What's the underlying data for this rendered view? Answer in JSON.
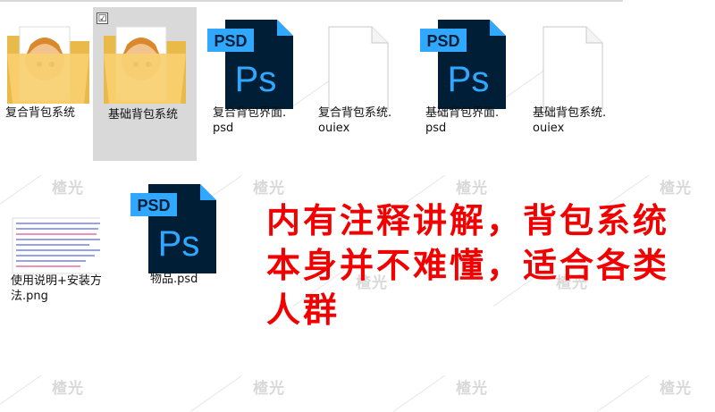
{
  "watermark": "楂光",
  "files": [
    {
      "name": "复合背包系统",
      "type": "folder"
    },
    {
      "name": "基础背包系统",
      "type": "folder",
      "selected": true,
      "checkbox": "☑"
    },
    {
      "name": "复合背包界面.\npsd",
      "type": "psd",
      "badge": "PSD",
      "logo": "Ps"
    },
    {
      "name": "复合背包系统.\nouiex",
      "type": "blank"
    },
    {
      "name": "基础背包界面.\npsd",
      "type": "psd",
      "badge": "PSD",
      "logo": "Ps"
    },
    {
      "name": "基础背包系统.\nouiex",
      "type": "blank"
    },
    {
      "name": "使用说明+安装方\n法.png",
      "type": "png"
    },
    {
      "name": "物品.psd",
      "type": "psd",
      "badge": "PSD",
      "logo": "Ps"
    }
  ],
  "annotation": "内有注释讲解，背包系统\n本身并不难懂，适合各类\n人群",
  "colors": {
    "psd_blue": "#31a8ff",
    "psd_dark": "#001e36",
    "annotation_red": "#f20000",
    "folder": "#f5c45e"
  }
}
